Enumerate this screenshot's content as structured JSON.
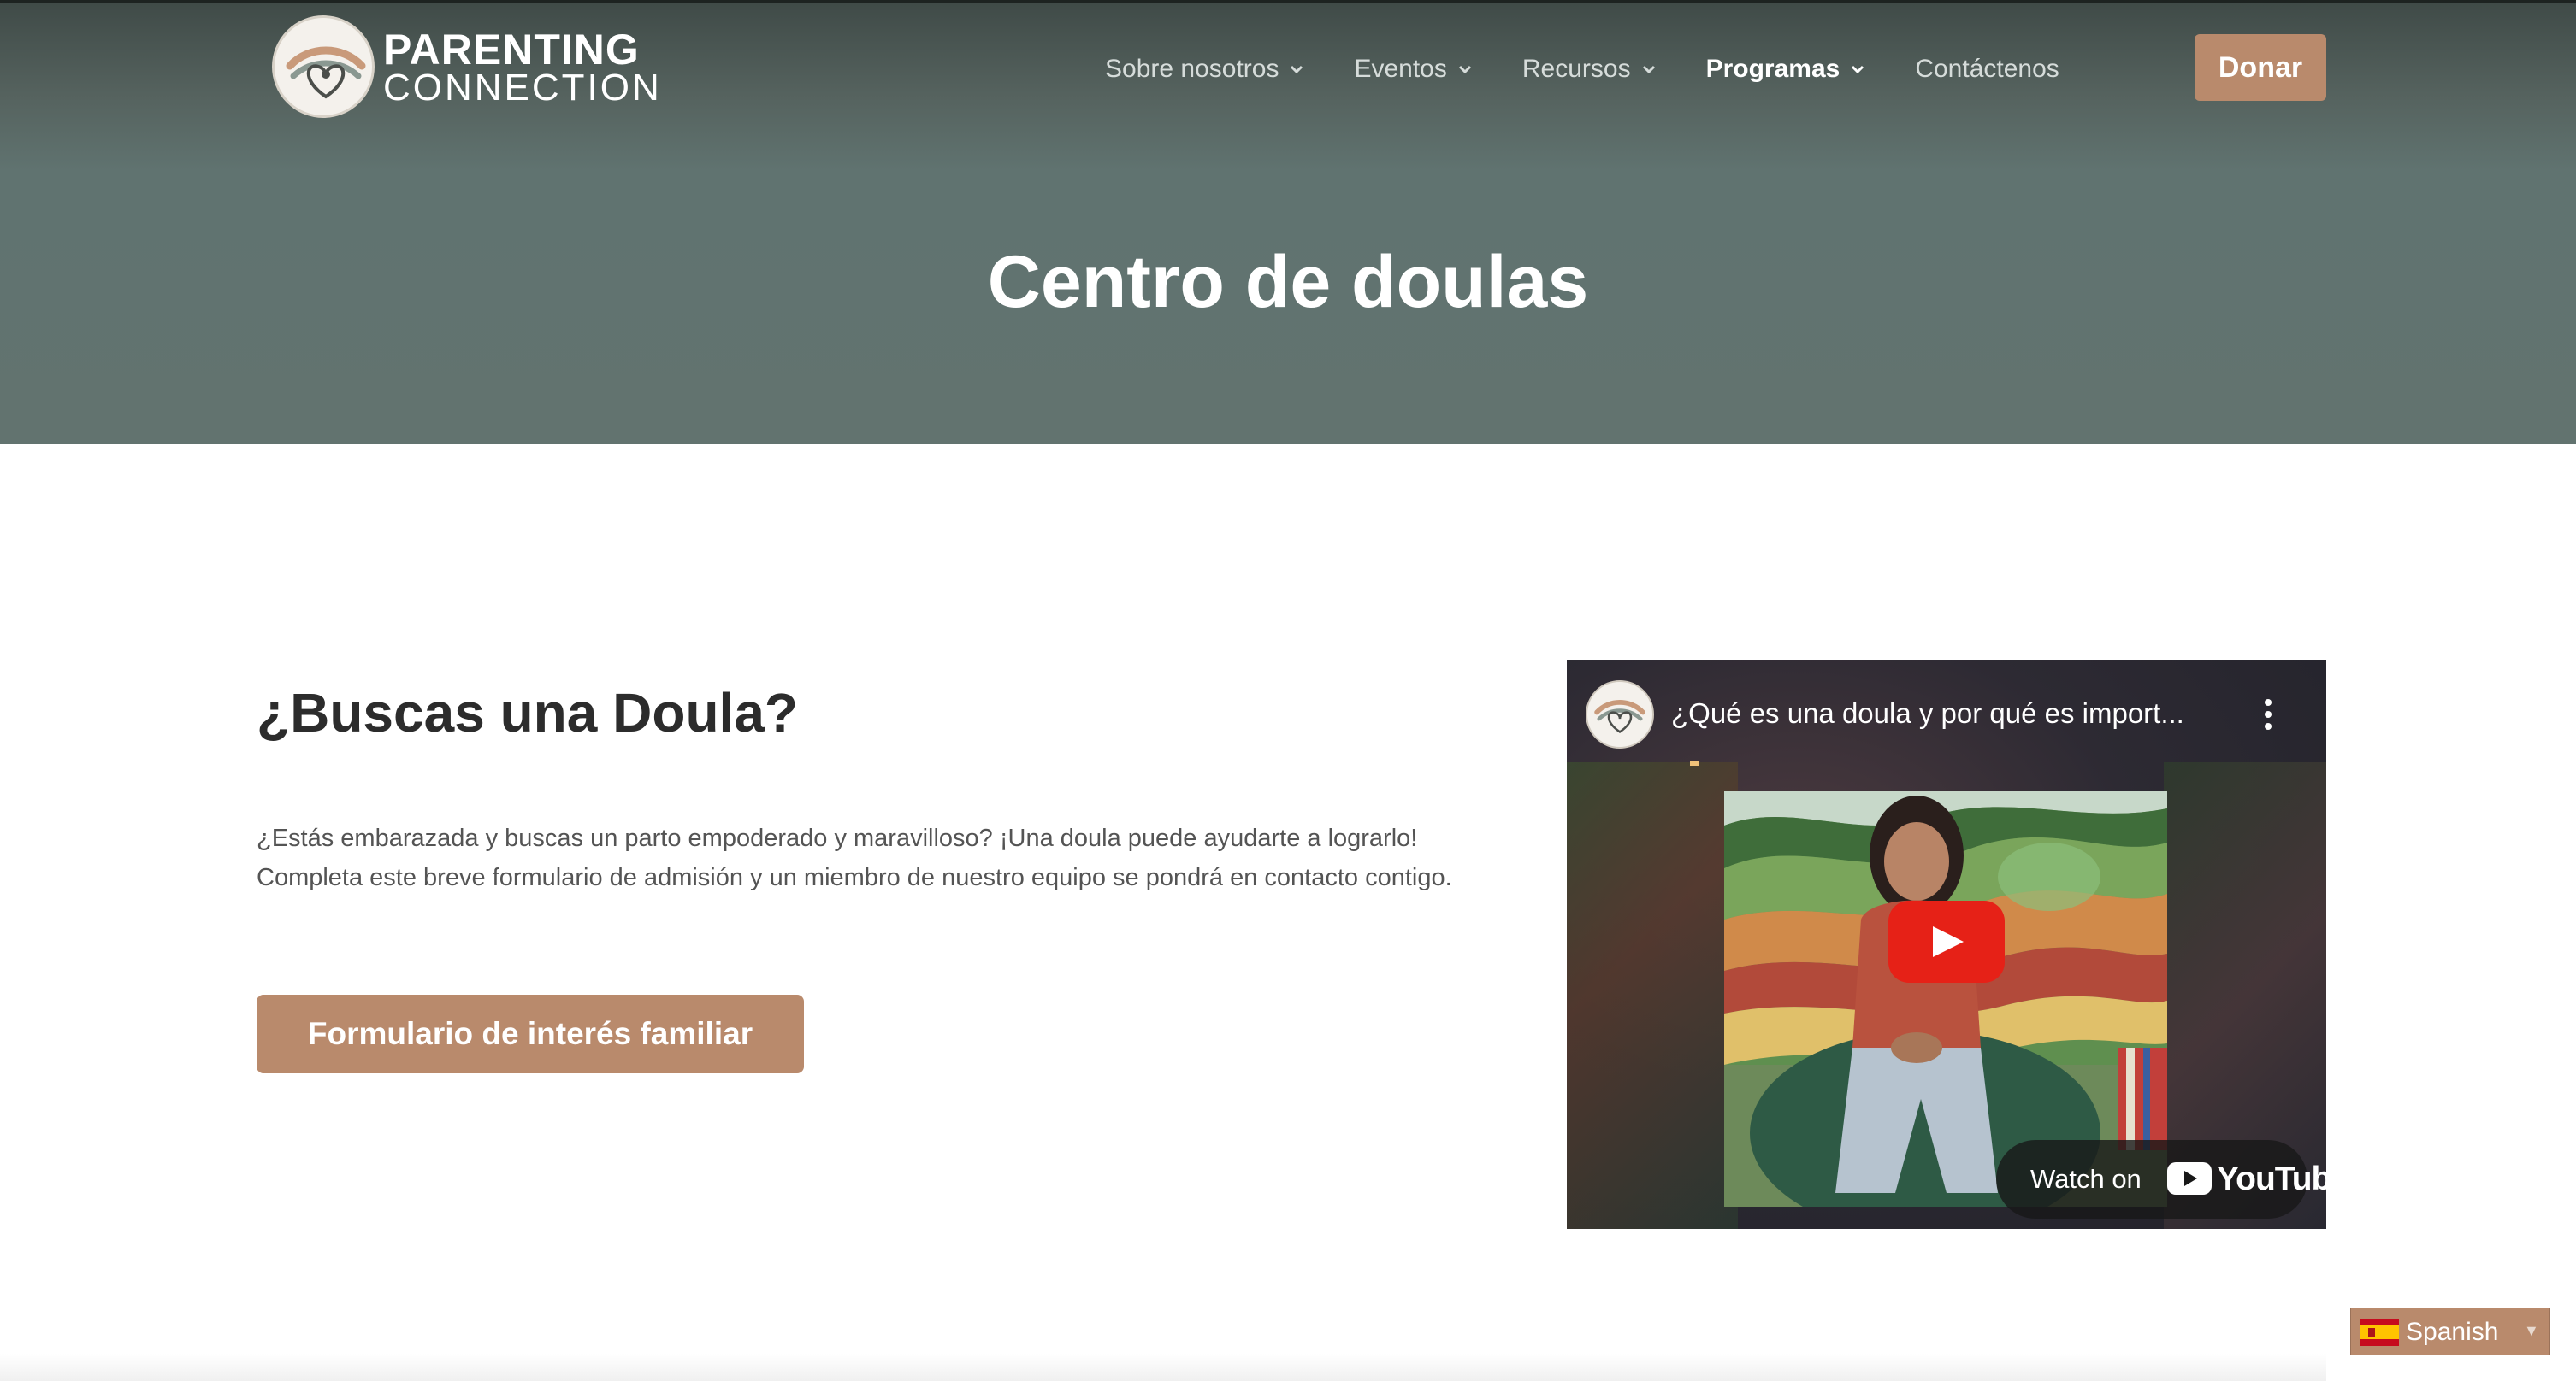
{
  "brand": {
    "name_line1": "PARENTING",
    "name_line2": "CONNECTION",
    "accent_color": "#b98a6c",
    "hero_color": "#62736f"
  },
  "nav": {
    "items": [
      {
        "label": "Sobre nosotros",
        "has_dropdown": true,
        "active": false
      },
      {
        "label": "Eventos",
        "has_dropdown": true,
        "active": false
      },
      {
        "label": "Recursos",
        "has_dropdown": true,
        "active": false
      },
      {
        "label": "Programas",
        "has_dropdown": true,
        "active": true
      },
      {
        "label": "Contáctenos",
        "has_dropdown": false,
        "active": false
      }
    ],
    "donate_label": "Donar"
  },
  "hero": {
    "title": "Centro de doulas"
  },
  "main": {
    "heading": "¿Buscas una Doula?",
    "paragraph": "¿Estás embarazada y buscas un parto empoderado y maravilloso? ¡Una doula puede ayudarte a lograrlo! Completa este breve formulario de admisión y un miembro de nuestro equipo se pondrá en contacto contigo.",
    "cta_label": "Formulario de interés familiar"
  },
  "video": {
    "title": "¿Qué es una doula y por qué es import...",
    "watch_on_label": "Watch on",
    "platform_wordmark": "YouTube",
    "icons": [
      "channel-avatar-icon",
      "kebab-menu-icon",
      "play-icon",
      "youtube-logo-icon"
    ]
  },
  "language_switcher": {
    "label": "Spanish",
    "flag_icon": "spain-flag-icon"
  }
}
